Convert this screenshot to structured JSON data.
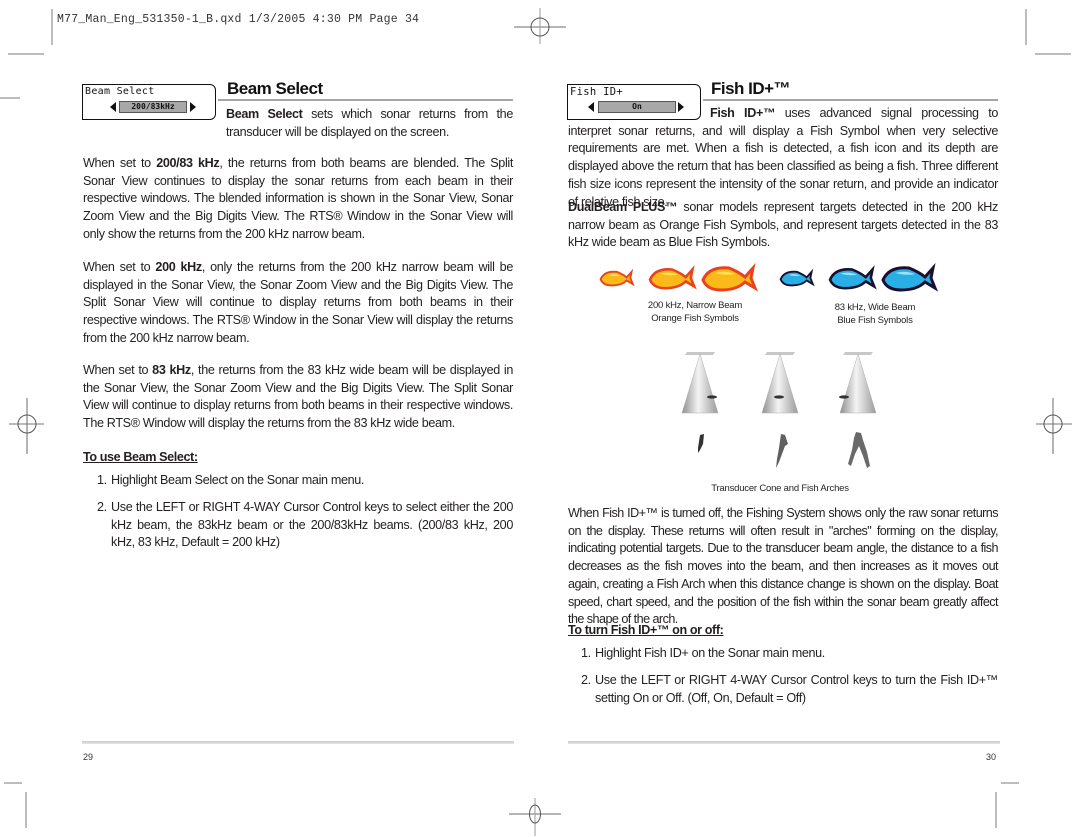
{
  "slug_line": "M77_Man_Eng_531350-1_B.qxd  1/3/2005  4:30 PM  Page 34",
  "left_page": {
    "menu": {
      "title": "Beam Select",
      "value": "200/83kHz"
    },
    "title": "Beam Select",
    "intro_bold": "Beam Select",
    "intro_rest": " sets which sonar returns from the transducer will be displayed on the screen.",
    "paragraphs": [
      {
        "pre": "When set to ",
        "bold": "200/83 kHz",
        "post": ", the returns from both beams are blended. The Split Sonar View continues to display the sonar returns from each beam in their respective windows. The blended information is shown in the Sonar View, Sonar Zoom View and the Big Digits View. The RTS® Window in the Sonar View will only show the returns from the 200 kHz narrow beam."
      },
      {
        "pre": "When set to ",
        "bold": "200 kHz",
        "post": ", only the returns from the 200 kHz narrow beam will be displayed in the Sonar View, the Sonar Zoom View and the Big Digits View. The Split Sonar View will continue to display returns from both beams in their respective windows. The RTS® Window in the Sonar View will display the returns from the 200 kHz narrow beam."
      },
      {
        "pre": "When set to ",
        "bold": "83 kHz",
        "post": ", the returns from the 83 kHz wide beam will be displayed in the Sonar View, the Sonar Zoom View and the Big Digits View. The Split Sonar View will continue to display returns from both beams in their respective windows. The RTS® Window will display the returns from the 83 kHz wide beam."
      }
    ],
    "subhead": "To use Beam Select:",
    "steps": [
      {
        "num": "1.",
        "text": "Highlight Beam Select on the Sonar main menu."
      },
      {
        "num": "2.",
        "text": "Use the LEFT or RIGHT 4-WAY Cursor Control keys to select either the 200 kHz beam, the 83kHz beam or the 200/83kHz beams. (200/83 kHz, 200 kHz, 83 kHz, Default = 200 kHz)"
      }
    ],
    "page_number": "29"
  },
  "right_page": {
    "menu": {
      "title": "Fish ID+",
      "value": "On"
    },
    "title": "Fish ID+™",
    "intro_bold": "Fish ID+™",
    "intro_rest": " uses advanced signal processing to interpret sonar returns, and will display a Fish Symbol when very selective requirements are met. When a fish is detected, a fish icon and its depth are displayed above the return that has been classified as being a fish. Three different fish size icons represent the intensity of the sonar return, and provide an indicator of relative fish size.",
    "dualbeam_bold": "DualBeam PLUS™",
    "dualbeam_rest": " sonar models represent targets detected in the 200 kHz narrow beam as Orange Fish Symbols, and represent targets detected in the 83 kHz wide beam as Blue Fish Symbols.",
    "fish_groups": [
      {
        "caption_line1": "200 kHz, Narrow Beam",
        "caption_line2": "Orange Fish Symbols",
        "fill": "#fbb91a",
        "outline": "#e8421e",
        "highlight": "#ffe25a"
      },
      {
        "caption_line1": "83 kHz, Wide Beam",
        "caption_line2": "Blue Fish Symbols",
        "fill": "#29aee6",
        "outline": "#1a0f2e",
        "highlight": "#9fe0f7"
      }
    ],
    "figure_caption": "Transducer Cone and Fish Arches",
    "paragraph": "When Fish ID+™ is turned off, the Fishing System shows only the raw sonar returns on the display. These returns will often result in \"arches\" forming on the display, indicating potential targets. Due to the transducer beam angle, the distance to a fish decreases as the fish moves into the beam, and then increases as it moves out again, creating a Fish Arch when this distance change is shown on the display. Boat speed, chart speed, and the position of the fish within the sonar beam greatly affect the shape of the arch.",
    "subhead": "To turn Fish ID+™ on or off:",
    "steps": [
      {
        "num": "1.",
        "text": "Highlight Fish ID+ on the Sonar main menu."
      },
      {
        "num": "2.",
        "text": "Use the LEFT or RIGHT 4-WAY Cursor Control keys to turn the Fish ID+™ setting On or Off. (Off, On, Default = Off)"
      }
    ],
    "page_number": "30"
  }
}
